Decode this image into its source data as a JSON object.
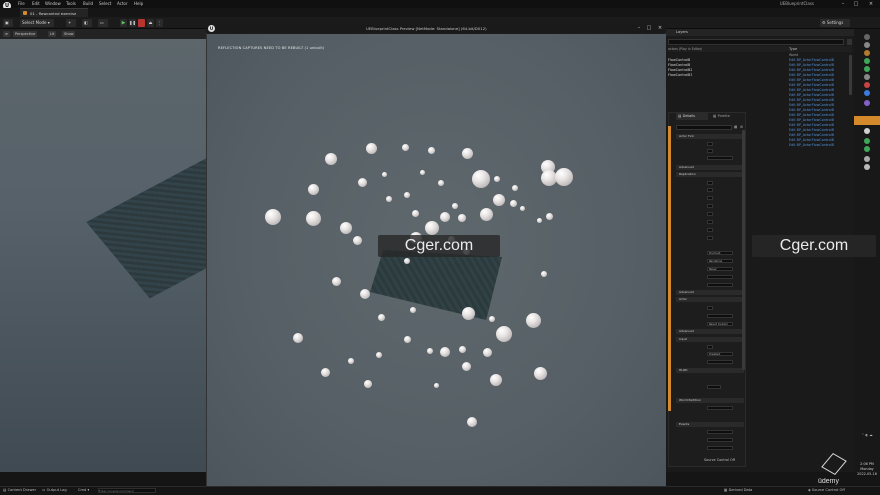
{
  "menubar": {
    "items": [
      "File",
      "Edit",
      "Window",
      "Tools",
      "Build",
      "Select",
      "Actor",
      "Help"
    ],
    "project": "UEBlueprintClass"
  },
  "tabs": {
    "level_tab": "01 - flowcontrol exercise"
  },
  "toolbar": {
    "mode": "Select Mode",
    "settings": "Settings"
  },
  "viewport": {
    "perspective": "Perspective",
    "lit": "Lit",
    "show": "Show"
  },
  "pie": {
    "title": "UEBlueprintClass Preview [NetMode: Standalone] (64-bit/DX12)",
    "warning": "REFLECTION CAPTURES NEED TO BE REBUILT (1 unbuilt)"
  },
  "outliner": {
    "tab": "Layers",
    "filter_hint": "actors (Play in Editor)",
    "type_header": "Type",
    "world_row": "World",
    "rows": [
      {
        "name": "FlowControlB",
        "type": "Edit BP_ActorFlowControlB"
      },
      {
        "name": "FlowControlB",
        "type": "Edit BP_ActorFlowControlB"
      },
      {
        "name": "FlowControlB2",
        "type": "Edit BP_ActorFlowControlB"
      },
      {
        "name": "FlowControlB3",
        "type": "Edit BP_ActorFlowControlB"
      },
      {
        "name": "",
        "type": "Edit BP_ActorFlowControlB"
      },
      {
        "name": "",
        "type": "Edit BP_ActorFlowControlB"
      },
      {
        "name": "",
        "type": "Edit BP_ActorFlowControlB"
      },
      {
        "name": "",
        "type": "Edit BP_ActorFlowControlB"
      },
      {
        "name": "",
        "type": "Edit BP_ActorFlowControlB"
      },
      {
        "name": "",
        "type": "Edit BP_ActorFlowControlB"
      },
      {
        "name": "",
        "type": "Edit BP_ActorFlowControlB"
      },
      {
        "name": "",
        "type": "Edit BP_ActorFlowControlB"
      },
      {
        "name": "",
        "type": "Edit BP_ActorFlowControlB"
      },
      {
        "name": "",
        "type": "Edit BP_ActorFlowControlB"
      },
      {
        "name": "",
        "type": "Edit BP_ActorFlowControlB"
      },
      {
        "name": "",
        "type": "Edit BP_ActorFlowControlB"
      },
      {
        "name": "",
        "type": "Edit BP_ActorFlowControlB"
      },
      {
        "name": "",
        "type": "Edit BP_ActorFlowControlB"
      }
    ]
  },
  "details": {
    "details_tab": "Details",
    "palette_tab": "Palette",
    "sections": [
      "Actor Tick",
      "Advanced",
      "Replication",
      "Advanced",
      "Actor",
      "Advanced",
      "Input",
      "HLOD",
      "World Partition",
      "Events"
    ],
    "replication_values": [
      "Dormant",
      "Rendering",
      "Never"
    ],
    "actor_value": "Reject Custom",
    "input_value": "Disabled"
  },
  "statusbar": {
    "content_drawer": "Content Drawer",
    "output_log": "Output Log",
    "cmd": "Cmd",
    "cmd_placeholder": "Enter Console Command",
    "derived_data": "Derived Data",
    "source_control": "Source Control Off"
  },
  "details_footer": {
    "source_control": "Source Control Off"
  },
  "watermarks": {
    "center": "Cger.com",
    "right": "Cger.com"
  },
  "branding": {
    "udemy": "ûdemy"
  },
  "clock": {
    "time": "2:06 PM",
    "day": "Monday",
    "date": "2022-05-16"
  },
  "colors": {
    "accent": "#d4892a",
    "link": "#4f8fd6",
    "background": "#1a1a1a"
  }
}
